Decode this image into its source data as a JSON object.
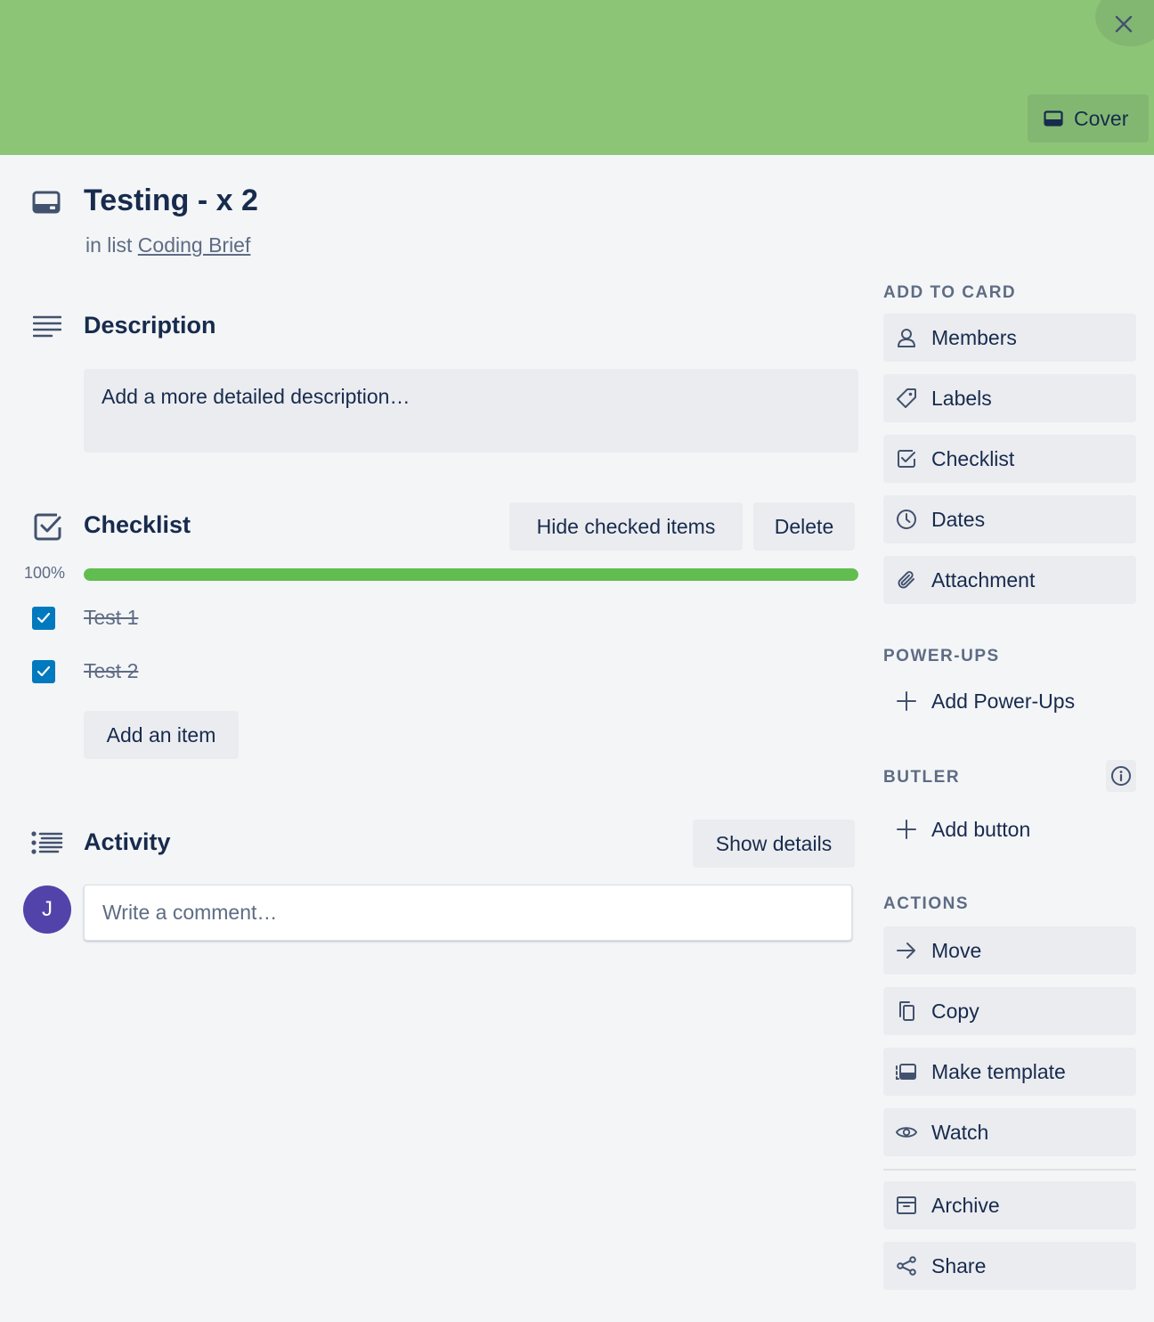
{
  "cover": {
    "color": "#8dc577",
    "cover_button_label": "Cover"
  },
  "card": {
    "title": "Testing - x 2",
    "in_list_prefix": "in list",
    "list_name": "Coding Brief"
  },
  "description": {
    "heading": "Description",
    "placeholder": "Add a more detailed description…"
  },
  "checklist": {
    "heading": "Checklist",
    "hide_checked_label": "Hide checked items",
    "delete_label": "Delete",
    "progress_label": "100%",
    "progress": 1.0,
    "progress_color": "#61bd4f",
    "items": [
      {
        "text": "Test 1",
        "checked": true
      },
      {
        "text": "Test 2",
        "checked": true
      }
    ],
    "add_item_label": "Add an item"
  },
  "activity": {
    "heading": "Activity",
    "show_details_label": "Show details",
    "avatar_initial": "J",
    "avatar_color": "#5243aa",
    "comment_placeholder": "Write a comment…"
  },
  "sidebar": {
    "add_to_card": {
      "heading": "ADD TO CARD",
      "items": [
        {
          "label": "Members",
          "icon": "person-icon"
        },
        {
          "label": "Labels",
          "icon": "tag-icon"
        },
        {
          "label": "Checklist",
          "icon": "checkbox-icon"
        },
        {
          "label": "Dates",
          "icon": "clock-icon"
        },
        {
          "label": "Attachment",
          "icon": "paperclip-icon"
        }
      ]
    },
    "power_ups": {
      "heading": "POWER-UPS",
      "add_label": "Add Power-Ups"
    },
    "butler": {
      "heading": "BUTLER",
      "add_label": "Add button"
    },
    "actions": {
      "heading": "ACTIONS",
      "items": [
        {
          "label": "Move",
          "icon": "arrow-right-icon"
        },
        {
          "label": "Copy",
          "icon": "copy-icon"
        },
        {
          "label": "Make template",
          "icon": "template-icon"
        },
        {
          "label": "Watch",
          "icon": "eye-icon"
        },
        {
          "label": "Archive",
          "icon": "archive-icon"
        },
        {
          "label": "Share",
          "icon": "share-icon"
        }
      ]
    }
  }
}
